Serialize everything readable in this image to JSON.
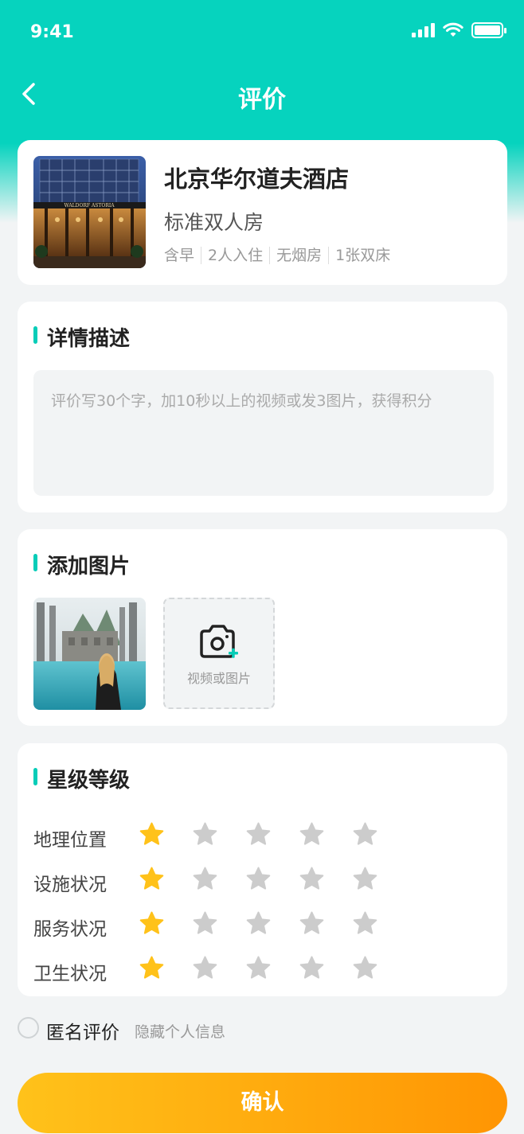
{
  "status_bar": {
    "time": "9:41"
  },
  "nav": {
    "title": "评价"
  },
  "hotel": {
    "name": "北京华尔道夫酒店",
    "room_type": "标准双人房",
    "tags": [
      "含早",
      "2人入住",
      "无烟房",
      "1张双床"
    ],
    "image_sign": "WALDORF ASTORIA"
  },
  "description": {
    "title": "详情描述",
    "placeholder": "评价写30个字，加10秒以上的视频或发3图片，获得积分"
  },
  "photos": {
    "title": "添加图片",
    "upload_label": "视频或图片"
  },
  "ratings": {
    "title": "星级等级",
    "max": 5,
    "items": [
      {
        "label": "地理位置",
        "value": 1
      },
      {
        "label": "设施状况",
        "value": 1
      },
      {
        "label": "服务状况",
        "value": 1
      },
      {
        "label": "卫生状况",
        "value": 1
      }
    ]
  },
  "anonymous": {
    "label": "匿名评价",
    "hint": "隐藏个人信息",
    "checked": false
  },
  "confirm_button": {
    "label": "确认"
  },
  "colors": {
    "primary": "#06d3be",
    "star_active": "#ffc21a",
    "star_inactive": "#cccccc",
    "button_start": "#ffc21a",
    "button_end": "#ff9503"
  }
}
